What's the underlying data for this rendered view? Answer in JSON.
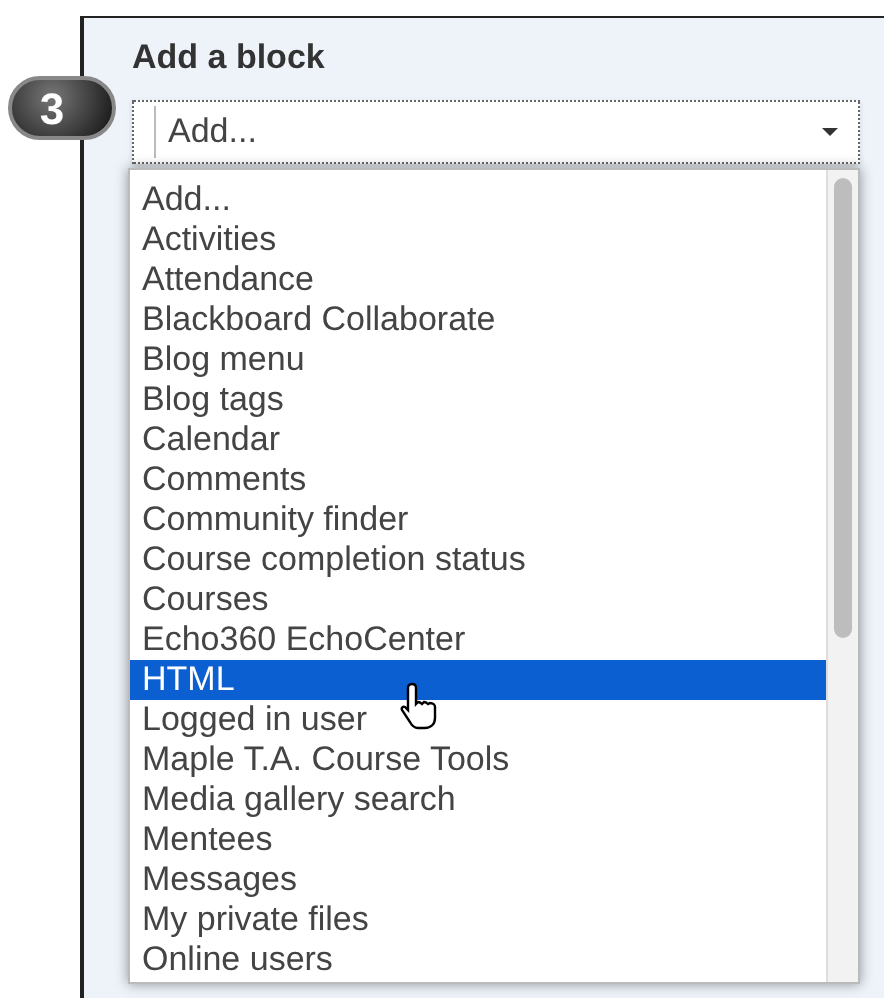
{
  "step_badge": "3",
  "block_title": "Add a block",
  "select": {
    "value": "Add..."
  },
  "options": [
    {
      "label": "Add...",
      "selected": false
    },
    {
      "label": "Activities",
      "selected": false
    },
    {
      "label": "Attendance",
      "selected": false
    },
    {
      "label": "Blackboard Collaborate",
      "selected": false
    },
    {
      "label": "Blog menu",
      "selected": false
    },
    {
      "label": "Blog tags",
      "selected": false
    },
    {
      "label": "Calendar",
      "selected": false
    },
    {
      "label": "Comments",
      "selected": false
    },
    {
      "label": "Community finder",
      "selected": false
    },
    {
      "label": "Course completion status",
      "selected": false
    },
    {
      "label": "Courses",
      "selected": false
    },
    {
      "label": "Echo360 EchoCenter",
      "selected": false
    },
    {
      "label": "HTML",
      "selected": true
    },
    {
      "label": "Logged in user",
      "selected": false
    },
    {
      "label": "Maple T.A. Course Tools",
      "selected": false
    },
    {
      "label": "Media gallery search",
      "selected": false
    },
    {
      "label": "Mentees",
      "selected": false
    },
    {
      "label": "Messages",
      "selected": false
    },
    {
      "label": "My private files",
      "selected": false
    },
    {
      "label": "Online users",
      "selected": false
    }
  ]
}
